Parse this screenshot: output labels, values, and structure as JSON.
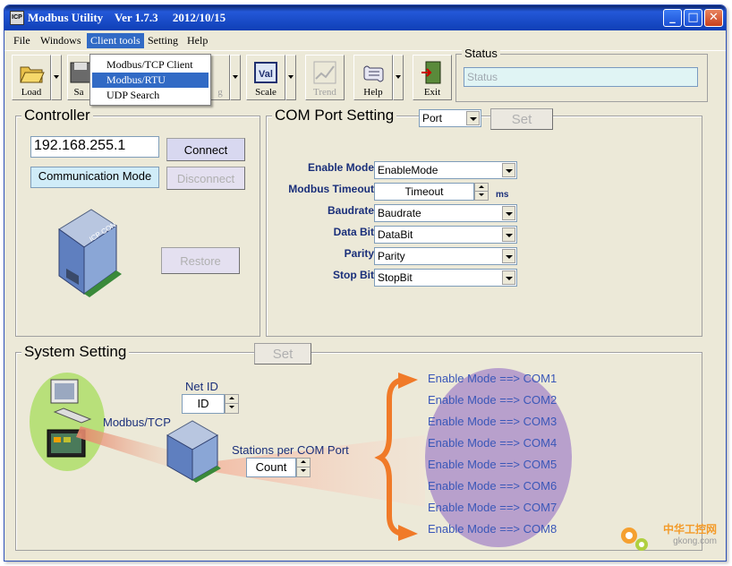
{
  "window": {
    "icon_text": "ICP",
    "title": "Modbus Utility    Ver 1.7.3     2012/10/15",
    "controls": {
      "minimize": "_",
      "maximize": "□",
      "close": "✕"
    }
  },
  "menu": {
    "items": [
      "File",
      "Windows",
      "Client tools",
      "Setting",
      "Help"
    ],
    "active": "Client tools",
    "dropdown": [
      "Modbus/TCP Client",
      "Modbus/RTU Client",
      "UDP Search"
    ],
    "dropdown_selected": "Modbus/RTU Client"
  },
  "toolbar": {
    "buttons": [
      {
        "label": "Load",
        "icon": "folder-open-icon",
        "enabled": true
      },
      {
        "label": "Sa",
        "icon": "save-icon",
        "enabled": true
      },
      {
        "label": "g",
        "icon": "log-icon",
        "enabled": false
      },
      {
        "label": "Scale",
        "icon": "val-scale-icon",
        "icon_text": "Val",
        "enabled": true
      },
      {
        "label": "Trend",
        "icon": "trend-chart-icon",
        "enabled": false
      },
      {
        "label": "Help",
        "icon": "scroll-help-icon",
        "enabled": true
      },
      {
        "label": "Exit",
        "icon": "exit-door-icon",
        "enabled": true
      }
    ],
    "status_caption": "Status",
    "status_value": "Status"
  },
  "controller": {
    "caption": "Controller",
    "ip": "192.168.255.1",
    "connect": "Connect",
    "disconnect": "Disconnect",
    "comm_mode": "Communication Mode",
    "restore": "Restore",
    "device_logo": "ICP CON"
  },
  "com_port": {
    "caption": "COM Port Setting",
    "port": "Port",
    "set": "Set",
    "fields": [
      {
        "label": "Enable Mode",
        "value": "EnableMode"
      },
      {
        "label": "Modbus Timeout",
        "value": "Timeout",
        "unit": "ms"
      },
      {
        "label": "Baudrate",
        "value": "Baudrate"
      },
      {
        "label": "Data Bit",
        "value": "DataBit"
      },
      {
        "label": "Parity",
        "value": "Parity"
      },
      {
        "label": "Stop Bit",
        "value": "StopBit"
      }
    ]
  },
  "system": {
    "caption": "System Setting",
    "set": "Set",
    "net_id_label": "Net ID",
    "net_id_value": "ID",
    "modbus_tcp": "Modbus/TCP",
    "stations_label": "Stations per COM Port",
    "stations_value": "Count",
    "enable_rows": [
      "Enable Mode ==> COM1",
      "Enable Mode ==> COM2",
      "Enable Mode ==> COM3",
      "Enable Mode ==> COM4",
      "Enable Mode ==> COM5",
      "Enable Mode ==> COM6",
      "Enable Mode ==> COM7",
      "Enable Mode ==> COM8"
    ]
  },
  "watermark": {
    "line1": "中华工控网",
    "line2": "gkong.com"
  },
  "colors": {
    "title_bar": "#0f3fb6",
    "menu_highlight": "#316ac5",
    "field_label": "#1a2f7a",
    "enable_text": "#3a57b8",
    "arrow_orange": "#f07a28",
    "oval_purple": "#b8a0cc",
    "pc_green": "#b8e07a"
  }
}
